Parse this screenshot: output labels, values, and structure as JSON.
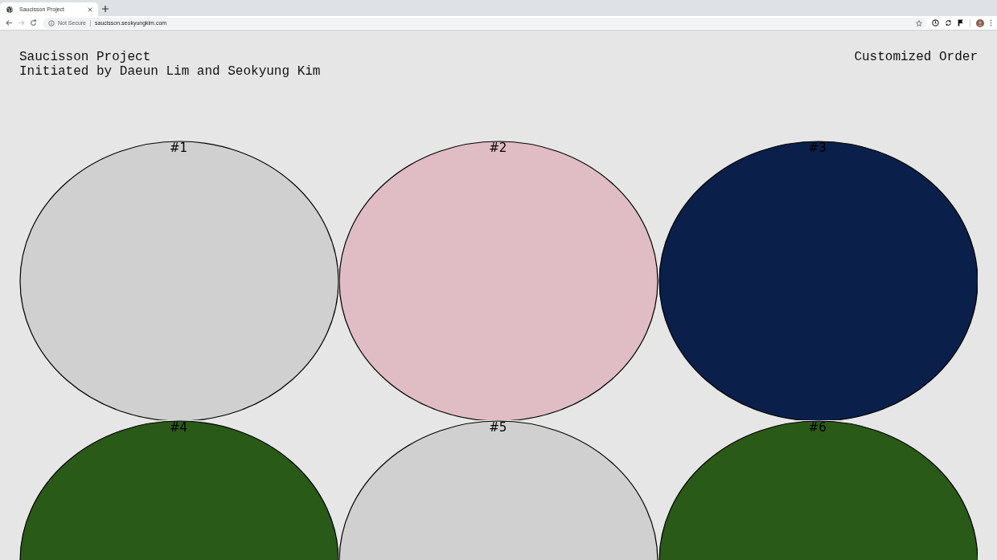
{
  "browser": {
    "tab": {
      "title": "Saucisson Project"
    },
    "nav_buttons": [
      {
        "kind": "back",
        "disabled": false
      },
      {
        "kind": "forward",
        "disabled": true
      },
      {
        "kind": "reload",
        "disabled": false
      }
    ],
    "address": {
      "security": "Not Secure",
      "url": "saucisson.seokyungkim.com"
    }
  },
  "header": {
    "title": "Saucisson Project",
    "subtitle": "Initiated by Daeun Lim and Seokyung Kim",
    "link": "Customized Order"
  },
  "items": [
    {
      "label": "#1",
      "color": "#d0d0d0"
    },
    {
      "label": "#2",
      "color": "#e0bcc4"
    },
    {
      "label": "#3",
      "color": "#0a204a"
    },
    {
      "label": "#4",
      "color": "#2a5a17"
    },
    {
      "label": "#5",
      "color": "#d0d0d0"
    },
    {
      "label": "#6",
      "color": "#2a5a17"
    }
  ]
}
